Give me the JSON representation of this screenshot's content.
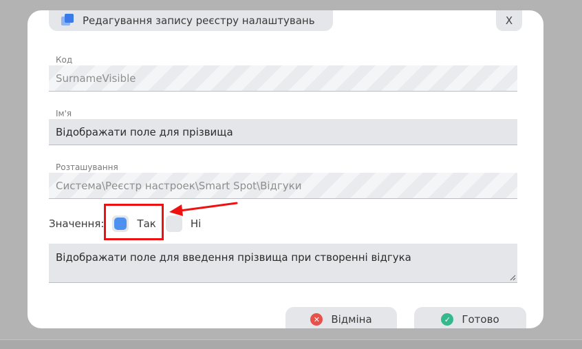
{
  "dialog": {
    "title": "Редагування запису реєстру налаштувань",
    "close_label": "X"
  },
  "fields": {
    "code": {
      "label": "Код",
      "value": "SurnameVisible"
    },
    "name": {
      "label": "Ім'я",
      "value": "Відображати поле для прізвища"
    },
    "location": {
      "label": "Розташування",
      "value": "Система\\Реєстр настроек\\Smart Spot\\Відгуки"
    }
  },
  "value_choice": {
    "label": "Значення:",
    "options": [
      {
        "label": "Так",
        "selected": true
      },
      {
        "label": "Ні",
        "selected": false
      }
    ]
  },
  "description": "Відображати поле для введення прізвища при створенні відгука",
  "buttons": {
    "cancel": "Відміна",
    "done": "Готово"
  },
  "icons": {
    "title": "registry-icon",
    "cancel": "close-circle-icon",
    "done": "check-circle-icon"
  },
  "colors": {
    "accent": "#4d90f0",
    "annotation": "#ee1111",
    "cancel": "#e8504a",
    "done": "#35b88c"
  }
}
